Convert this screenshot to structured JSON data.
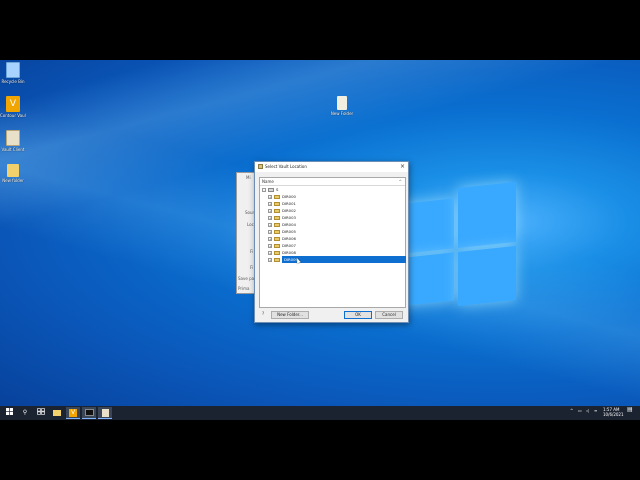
{
  "desktop": {
    "icons": [
      {
        "label": "Recycle Bin",
        "icon": "recycle-bin-icon",
        "color": "#a9d3ff"
      },
      {
        "label": "Contour Vault Admin",
        "icon": "vault-app-icon",
        "color": "#f0a500"
      },
      {
        "label": "Vault Client",
        "icon": "vault-client-icon",
        "color": "#e8e0c8"
      },
      {
        "label": "New folder",
        "icon": "folder-icon",
        "color": "#f2d06b"
      },
      {
        "label": "New Folder",
        "icon": "folder-icon",
        "color": "#f2efe0"
      }
    ]
  },
  "background_dialog": {
    "title": "Mi",
    "labels": [
      "Sour",
      "Loc",
      "Fi",
      "Fi",
      "Save pat",
      "Prima"
    ]
  },
  "dialog": {
    "title": "Select Vault Location",
    "close": "×",
    "column_header": "Name",
    "root": "S",
    "items": [
      "DIR000",
      "DIR001",
      "DIR002",
      "DIR003",
      "DIR004",
      "DIR005",
      "DIR006",
      "DIR007",
      "DIR008",
      "DIR009"
    ],
    "selected_index": 9,
    "new_folder_label": "New Folder...",
    "ok_label": "OK",
    "cancel_label": "Cancel",
    "help": "?"
  },
  "taskbar": {
    "time": "1:57 AM",
    "date": "10/6/2021",
    "accent": "#7fb2ff"
  }
}
